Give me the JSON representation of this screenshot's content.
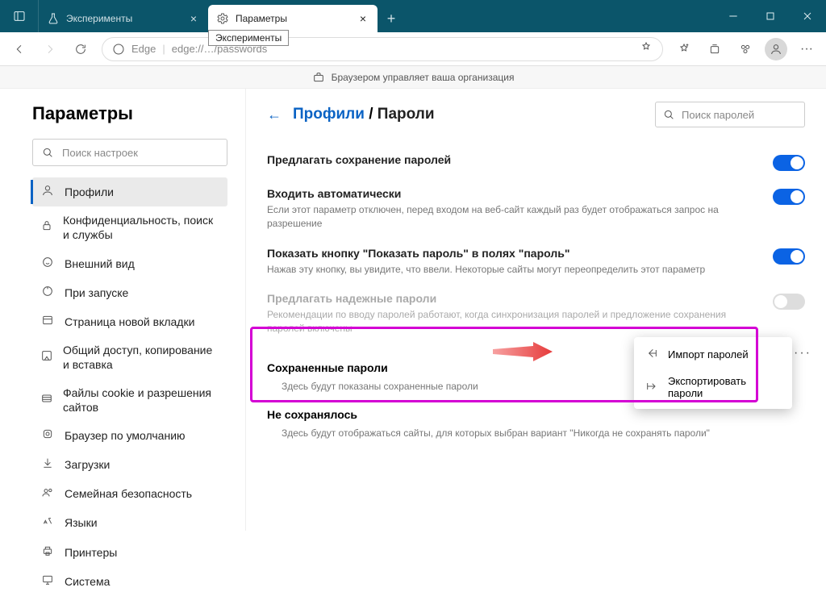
{
  "titlebar": {
    "tabs": [
      {
        "icon": "flask",
        "label": "Эксперименты"
      },
      {
        "icon": "gear",
        "label": "Параметры"
      }
    ],
    "tooltip": "Эксперименты"
  },
  "toolbar": {
    "edge_label": "Edge",
    "url": "edge://…/passwords"
  },
  "orgbar": {
    "text": "Браузером управляет ваша организация"
  },
  "sidebar": {
    "title": "Параметры",
    "search_placeholder": "Поиск настроек",
    "items": [
      "Профили",
      "Конфиденциальность, поиск и службы",
      "Внешний вид",
      "При запуске",
      "Страница новой вкладки",
      "Общий доступ, копирование и вставка",
      "Файлы cookie и разрешения сайтов",
      "Браузер по умолчанию",
      "Загрузки",
      "Семейная безопасность",
      "Языки",
      "Принтеры",
      "Система"
    ]
  },
  "main": {
    "crumb_link": "Профили",
    "crumb_sep": " / ",
    "crumb_current": "Пароли",
    "search_placeholder": "Поиск паролей",
    "rows": [
      {
        "title": "Предлагать сохранение паролей",
        "desc": "",
        "toggle": "on"
      },
      {
        "title": "Входить автоматически",
        "desc": "Если этот параметр отключен, перед входом на веб-сайт каждый раз будет отображаться запрос на разрешение",
        "toggle": "on"
      },
      {
        "title": "Показать кнопку \"Показать пароль\" в полях \"пароль\"",
        "desc": "Нажав эту кнопку, вы увидите, что ввели. Некоторые сайты могут переопределить этот параметр",
        "toggle": "on"
      },
      {
        "title": "Предлагать надежные пароли",
        "desc": "Рекомендации по вводу паролей работают, когда синхронизация паролей и предложение сохранения паролей включены",
        "toggle": "off",
        "disabled": true
      }
    ],
    "saved": {
      "title": "Сохраненные пароли",
      "desc": "Здесь будут показаны сохраненные пароли"
    },
    "never": {
      "title": "Не сохранялось",
      "desc": "Здесь будут отображаться сайты, для которых выбран вариант \"Никогда не сохранять пароли\""
    },
    "menu": {
      "import": "Импорт паролей",
      "export": "Экспортировать пароли"
    }
  }
}
